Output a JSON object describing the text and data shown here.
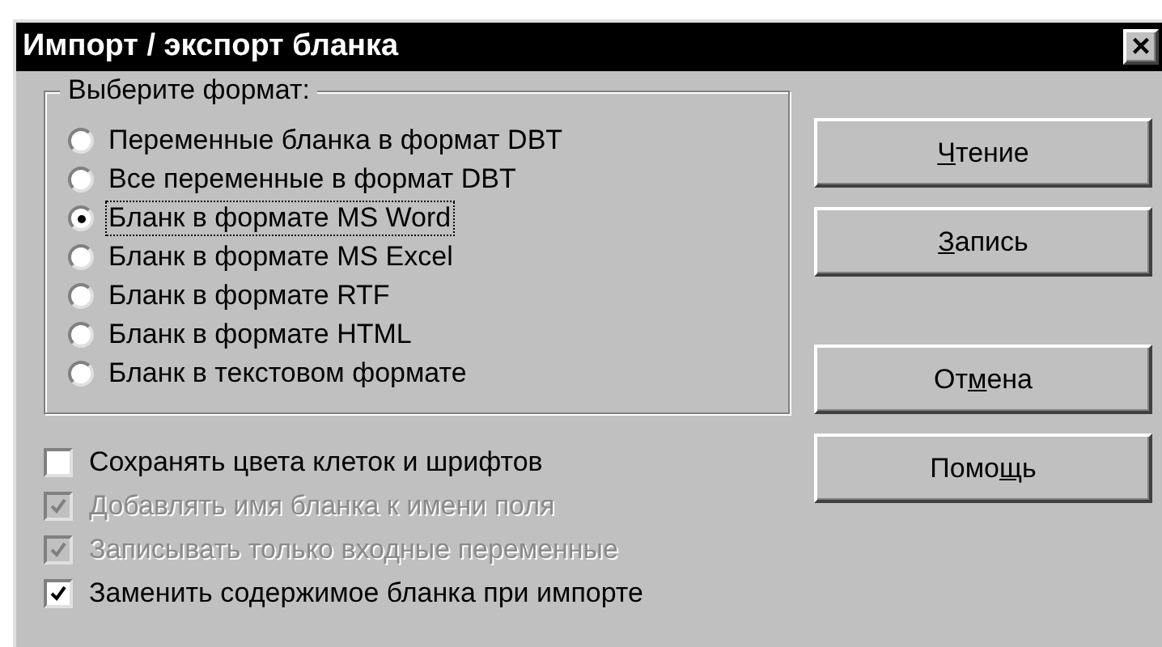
{
  "window": {
    "title": "Импорт / экспорт бланка",
    "close": "×"
  },
  "format_group": {
    "title": "Выберите формат:",
    "options": [
      {
        "label": "Переменные бланка в формат DBT",
        "selected": false
      },
      {
        "label": "Все переменные в формат DBT",
        "selected": false
      },
      {
        "label": "Бланк в формате MS Word",
        "selected": true
      },
      {
        "label": "Бланк в формате MS Excel",
        "selected": false
      },
      {
        "label": "Бланк в формате RTF",
        "selected": false
      },
      {
        "label": "Бланк в формате HTML",
        "selected": false
      },
      {
        "label": "Бланк в текстовом формате",
        "selected": false
      }
    ]
  },
  "options": [
    {
      "label": "Сохранять цвета клеток и шрифтов",
      "checked": false,
      "disabled": false
    },
    {
      "label": "Добавлять имя бланка к имени поля",
      "checked": true,
      "disabled": true
    },
    {
      "label": "Записывать только входные переменные",
      "checked": true,
      "disabled": true
    },
    {
      "label": "Заменить содержимое бланка при импорте",
      "checked": true,
      "disabled": false
    }
  ],
  "buttons": [
    {
      "accelerator": "Ч",
      "after": "тение"
    },
    {
      "accelerator": "З",
      "after": "апись"
    },
    {
      "before": "От",
      "accelerator": "м",
      "after": "ена"
    },
    {
      "before": "Помо",
      "accelerator": "щ",
      "after": "ь"
    }
  ]
}
